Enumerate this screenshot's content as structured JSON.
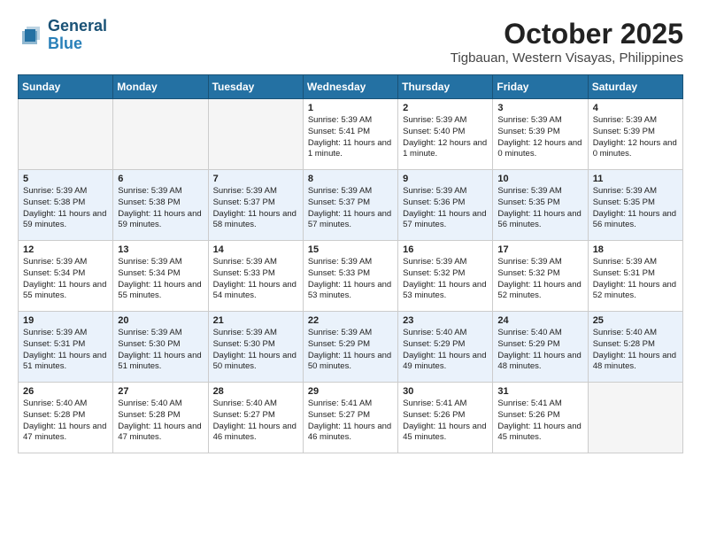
{
  "header": {
    "logo_line1": "General",
    "logo_line2": "Blue",
    "month": "October 2025",
    "location": "Tigbauan, Western Visayas, Philippines"
  },
  "days_of_week": [
    "Sunday",
    "Monday",
    "Tuesday",
    "Wednesday",
    "Thursday",
    "Friday",
    "Saturday"
  ],
  "weeks": [
    [
      {
        "day": null
      },
      {
        "day": null
      },
      {
        "day": null
      },
      {
        "day": "1",
        "sunrise": "Sunrise: 5:39 AM",
        "sunset": "Sunset: 5:41 PM",
        "daylight": "Daylight: 11 hours and 1 minute."
      },
      {
        "day": "2",
        "sunrise": "Sunrise: 5:39 AM",
        "sunset": "Sunset: 5:40 PM",
        "daylight": "Daylight: 12 hours and 1 minute."
      },
      {
        "day": "3",
        "sunrise": "Sunrise: 5:39 AM",
        "sunset": "Sunset: 5:39 PM",
        "daylight": "Daylight: 12 hours and 0 minutes."
      },
      {
        "day": "4",
        "sunrise": "Sunrise: 5:39 AM",
        "sunset": "Sunset: 5:39 PM",
        "daylight": "Daylight: 12 hours and 0 minutes."
      }
    ],
    [
      {
        "day": "5",
        "sunrise": "Sunrise: 5:39 AM",
        "sunset": "Sunset: 5:38 PM",
        "daylight": "Daylight: 11 hours and 59 minutes."
      },
      {
        "day": "6",
        "sunrise": "Sunrise: 5:39 AM",
        "sunset": "Sunset: 5:38 PM",
        "daylight": "Daylight: 11 hours and 59 minutes."
      },
      {
        "day": "7",
        "sunrise": "Sunrise: 5:39 AM",
        "sunset": "Sunset: 5:37 PM",
        "daylight": "Daylight: 11 hours and 58 minutes."
      },
      {
        "day": "8",
        "sunrise": "Sunrise: 5:39 AM",
        "sunset": "Sunset: 5:37 PM",
        "daylight": "Daylight: 11 hours and 57 minutes."
      },
      {
        "day": "9",
        "sunrise": "Sunrise: 5:39 AM",
        "sunset": "Sunset: 5:36 PM",
        "daylight": "Daylight: 11 hours and 57 minutes."
      },
      {
        "day": "10",
        "sunrise": "Sunrise: 5:39 AM",
        "sunset": "Sunset: 5:35 PM",
        "daylight": "Daylight: 11 hours and 56 minutes."
      },
      {
        "day": "11",
        "sunrise": "Sunrise: 5:39 AM",
        "sunset": "Sunset: 5:35 PM",
        "daylight": "Daylight: 11 hours and 56 minutes."
      }
    ],
    [
      {
        "day": "12",
        "sunrise": "Sunrise: 5:39 AM",
        "sunset": "Sunset: 5:34 PM",
        "daylight": "Daylight: 11 hours and 55 minutes."
      },
      {
        "day": "13",
        "sunrise": "Sunrise: 5:39 AM",
        "sunset": "Sunset: 5:34 PM",
        "daylight": "Daylight: 11 hours and 55 minutes."
      },
      {
        "day": "14",
        "sunrise": "Sunrise: 5:39 AM",
        "sunset": "Sunset: 5:33 PM",
        "daylight": "Daylight: 11 hours and 54 minutes."
      },
      {
        "day": "15",
        "sunrise": "Sunrise: 5:39 AM",
        "sunset": "Sunset: 5:33 PM",
        "daylight": "Daylight: 11 hours and 53 minutes."
      },
      {
        "day": "16",
        "sunrise": "Sunrise: 5:39 AM",
        "sunset": "Sunset: 5:32 PM",
        "daylight": "Daylight: 11 hours and 53 minutes."
      },
      {
        "day": "17",
        "sunrise": "Sunrise: 5:39 AM",
        "sunset": "Sunset: 5:32 PM",
        "daylight": "Daylight: 11 hours and 52 minutes."
      },
      {
        "day": "18",
        "sunrise": "Sunrise: 5:39 AM",
        "sunset": "Sunset: 5:31 PM",
        "daylight": "Daylight: 11 hours and 52 minutes."
      }
    ],
    [
      {
        "day": "19",
        "sunrise": "Sunrise: 5:39 AM",
        "sunset": "Sunset: 5:31 PM",
        "daylight": "Daylight: 11 hours and 51 minutes."
      },
      {
        "day": "20",
        "sunrise": "Sunrise: 5:39 AM",
        "sunset": "Sunset: 5:30 PM",
        "daylight": "Daylight: 11 hours and 51 minutes."
      },
      {
        "day": "21",
        "sunrise": "Sunrise: 5:39 AM",
        "sunset": "Sunset: 5:30 PM",
        "daylight": "Daylight: 11 hours and 50 minutes."
      },
      {
        "day": "22",
        "sunrise": "Sunrise: 5:39 AM",
        "sunset": "Sunset: 5:29 PM",
        "daylight": "Daylight: 11 hours and 50 minutes."
      },
      {
        "day": "23",
        "sunrise": "Sunrise: 5:40 AM",
        "sunset": "Sunset: 5:29 PM",
        "daylight": "Daylight: 11 hours and 49 minutes."
      },
      {
        "day": "24",
        "sunrise": "Sunrise: 5:40 AM",
        "sunset": "Sunset: 5:29 PM",
        "daylight": "Daylight: 11 hours and 48 minutes."
      },
      {
        "day": "25",
        "sunrise": "Sunrise: 5:40 AM",
        "sunset": "Sunset: 5:28 PM",
        "daylight": "Daylight: 11 hours and 48 minutes."
      }
    ],
    [
      {
        "day": "26",
        "sunrise": "Sunrise: 5:40 AM",
        "sunset": "Sunset: 5:28 PM",
        "daylight": "Daylight: 11 hours and 47 minutes."
      },
      {
        "day": "27",
        "sunrise": "Sunrise: 5:40 AM",
        "sunset": "Sunset: 5:28 PM",
        "daylight": "Daylight: 11 hours and 47 minutes."
      },
      {
        "day": "28",
        "sunrise": "Sunrise: 5:40 AM",
        "sunset": "Sunset: 5:27 PM",
        "daylight": "Daylight: 11 hours and 46 minutes."
      },
      {
        "day": "29",
        "sunrise": "Sunrise: 5:41 AM",
        "sunset": "Sunset: 5:27 PM",
        "daylight": "Daylight: 11 hours and 46 minutes."
      },
      {
        "day": "30",
        "sunrise": "Sunrise: 5:41 AM",
        "sunset": "Sunset: 5:26 PM",
        "daylight": "Daylight: 11 hours and 45 minutes."
      },
      {
        "day": "31",
        "sunrise": "Sunrise: 5:41 AM",
        "sunset": "Sunset: 5:26 PM",
        "daylight": "Daylight: 11 hours and 45 minutes."
      },
      {
        "day": null
      }
    ]
  ]
}
